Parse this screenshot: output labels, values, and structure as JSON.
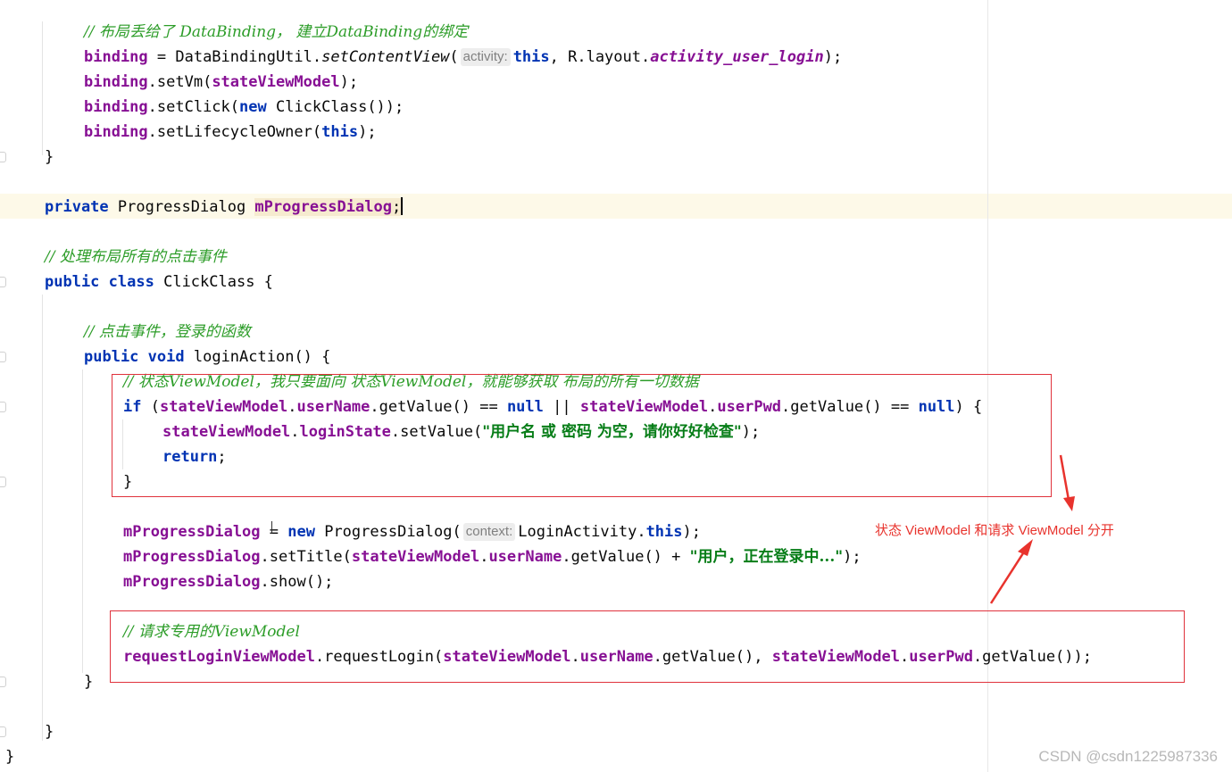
{
  "code": {
    "comment_layout_binding": "// 布局丢给了 DataBinding， 建立DataBinding的绑定",
    "binding": "binding",
    "assign": " = DataBindingUtil.",
    "set_content_view": "setContentView",
    "paren_open": "(",
    "hint_activity": "activity:",
    "this_kw": "this",
    "r_layout": ", R.layout.",
    "layout_name": "activity_user_login",
    "close_semicolon": ");",
    "set_vm": ".setVm(",
    "state_view_model": "stateViewModel",
    "set_click": ".setClick(",
    "new_kw": "new",
    "click_class_ctor": " ClickClass());",
    "set_lifecycle_owner": ".setLifecycleOwner(",
    "close_brace": "}",
    "private_kw": "private",
    "progress_dialog_type": " ProgressDialog ",
    "m_progress_dialog": "mProgressDialog",
    "semicolon": ";",
    "comment_click_events": "// 处理布局所有的点击事件",
    "public_kw": "public",
    "class_kw": "class",
    "click_class_decl": " ClickClass {",
    "comment_click_login": "// 点击事件，登录的函数",
    "void_kw": "void",
    "login_action": " loginAction() {",
    "comment_state_vm": "// 状态ViewModel，我只要面向 状态ViewModel，就能够获取 布局的所有一切数据",
    "if_kw": "if",
    "user_name": "userName",
    "user_pwd": "userPwd",
    "get_value_eq": ".getValue() == ",
    "null_kw": "null",
    "or_op": " || ",
    "open_brace": ") {",
    "login_state": "loginState",
    "set_value": ".setValue(",
    "str_empty_warning": "\"用户名 或 密码 为空，请你好好检查\"",
    "return_kw": "return",
    "new_progress_dialog": " ProgressDialog(",
    "hint_context": "context:",
    "login_activity": "LoginActivity.",
    "set_title": ".setTitle(",
    "get_value_plus": ".getValue() + ",
    "str_logging_in": "\"用户，正在登录中...\"",
    "show_call": ".show();",
    "comment_request_vm": "// 请求专用的ViewModel",
    "request_login_vm": "requestLoginViewModel",
    "request_login": ".requestLogin(",
    "get_value_comma": ".getValue(), ",
    "get_value_end": ".getValue());"
  },
  "annotation": {
    "note": "状态 ViewModel 和请求 ViewModel 分开",
    "color": "#e8332d"
  },
  "watermark": "CSDN @csdn1225987336"
}
